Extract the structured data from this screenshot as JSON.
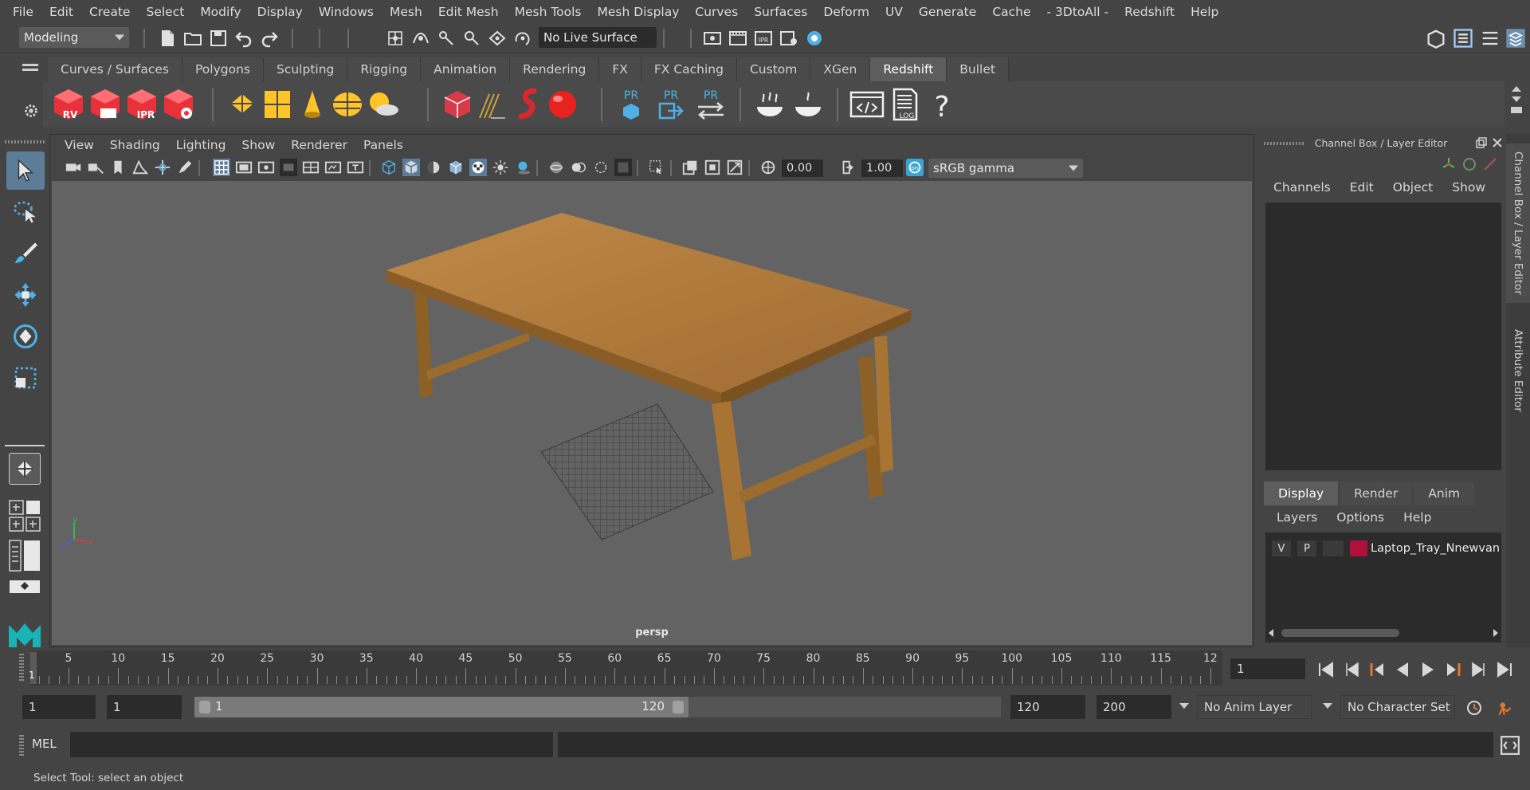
{
  "menubar": {
    "items": [
      "File",
      "Edit",
      "Create",
      "Select",
      "Modify",
      "Display",
      "Windows",
      "Mesh",
      "Edit Mesh",
      "Mesh Tools",
      "Mesh Display",
      "Curves",
      "Surfaces",
      "Deform",
      "UV",
      "Generate",
      "Cache",
      "- 3DtoAll -",
      "Redshift",
      "Help"
    ]
  },
  "statusline": {
    "mode": "Modeling",
    "live_surface": "No Live Surface"
  },
  "shelf": {
    "tabs": [
      "Curves / Surfaces",
      "Polygons",
      "Sculpting",
      "Rigging",
      "Animation",
      "Rendering",
      "FX",
      "FX Caching",
      "Custom",
      "XGen",
      "Redshift",
      "Bullet"
    ],
    "active_tab": "Redshift",
    "icon_labels": {
      "rv": "RV",
      "ipr": "IPR",
      "pr1": "PR",
      "pr2": "PR",
      "pr3": "PR",
      "log": "LOG",
      "help": "?"
    }
  },
  "panel": {
    "menu": [
      "View",
      "Shading",
      "Lighting",
      "Show",
      "Renderer",
      "Panels"
    ],
    "exposure": "0.00",
    "gamma": "1.00",
    "color_space": "sRGB gamma",
    "camera": "persp",
    "axis": {
      "x": "x",
      "y": "y",
      "z": "z"
    }
  },
  "channelbox": {
    "title": "Channel Box / Layer Editor",
    "menu": [
      "Channels",
      "Edit",
      "Object",
      "Show"
    ],
    "layer_tabs": [
      "Display",
      "Render",
      "Anim"
    ],
    "layer_menu": [
      "Layers",
      "Options",
      "Help"
    ],
    "layer": {
      "v": "V",
      "p": "P",
      "name": "Laptop_Tray_Nnewvan",
      "color": "#b0113a"
    },
    "side_tabs": [
      "Channel Box / Layer Editor",
      "Attribute Editor"
    ]
  },
  "timeslider": {
    "ticks": [
      "5",
      "10",
      "15",
      "20",
      "25",
      "30",
      "35",
      "40",
      "45",
      "50",
      "55",
      "60",
      "65",
      "70",
      "75",
      "80",
      "85",
      "90",
      "95",
      "100",
      "105",
      "110",
      "115",
      "12"
    ],
    "current_frame_marker": "1",
    "current_frame": "1"
  },
  "range": {
    "start": "1",
    "playback_start": "1",
    "slider_start": "1",
    "slider_end": "120",
    "playback_end": "120",
    "end": "200",
    "anim_layer": "No Anim Layer",
    "character_set": "No Character Set"
  },
  "cmdline": {
    "label": "MEL"
  },
  "helpline": {
    "text": "Select Tool: select an object"
  }
}
